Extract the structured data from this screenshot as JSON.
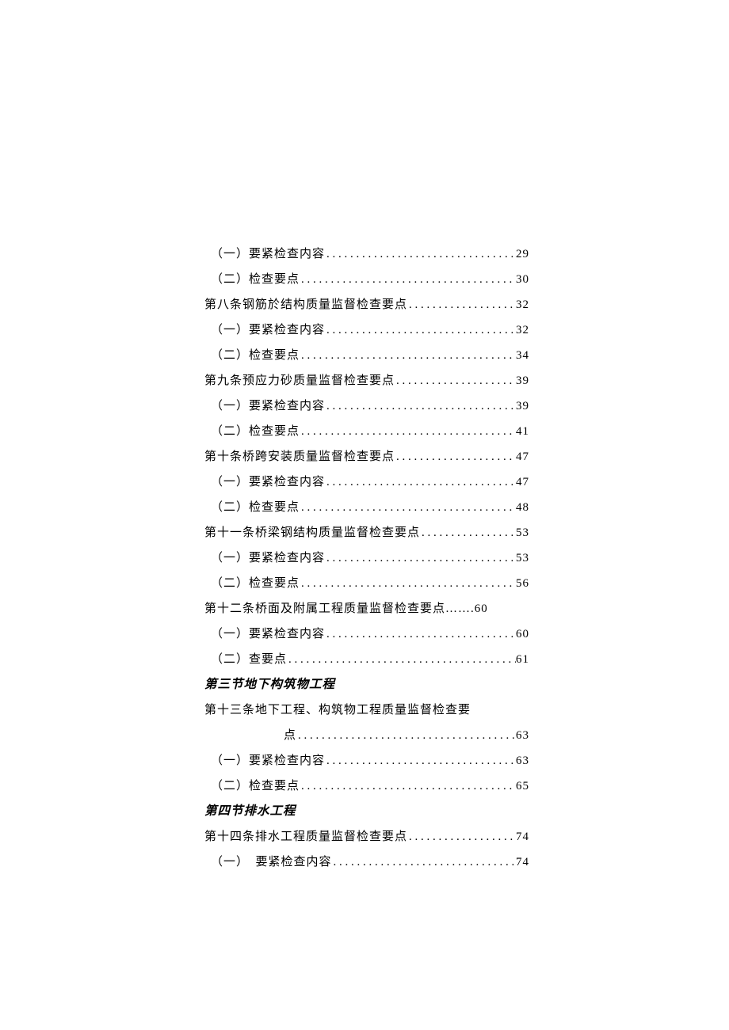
{
  "toc": {
    "entries": [
      {
        "label": "（一）要紧检查内容",
        "page": "29",
        "indent": true
      },
      {
        "label": "（二）检查要点",
        "page": "30",
        "indent": true
      },
      {
        "label": "第八条钢筋於结构质量监督检查要点",
        "page": "32",
        "indent": false
      },
      {
        "label": "（一）要紧检查内容",
        "page": "32",
        "indent": true
      },
      {
        "label": "（二）检查要点",
        "page": "34",
        "indent": true
      },
      {
        "label": "第九条预应力砂质量监督检查要点",
        "page": "39",
        "indent": false
      },
      {
        "label": "（一）要紧检查内容",
        "page": "39",
        "indent": true
      },
      {
        "label": "（二）检查要点",
        "page": "41",
        "indent": true
      },
      {
        "label": "第十条桥跨安装质量监督检查要点",
        "page": "47",
        "indent": false
      },
      {
        "label": "（一）要紧检查内容",
        "page": "47",
        "indent": true
      },
      {
        "label": "（二）检查要点",
        "page": "48",
        "indent": true
      },
      {
        "label": "第十一条桥梁钢结构质量监督检查要点",
        "page": "53",
        "indent": false
      },
      {
        "label": "（一）要紧检查内容",
        "page": "53",
        "indent": true
      },
      {
        "label": "（二）检查要点",
        "page": "56",
        "indent": true
      },
      {
        "label": "第十二条桥面及附属工程质量监督检查要点",
        "page": "60",
        "indent": false,
        "cndots": "……. "
      },
      {
        "label": "（一）要紧检查内容",
        "page": "60",
        "indent": true
      },
      {
        "label": "（二）查要点",
        "page": "61",
        "indent": true
      }
    ],
    "section3": {
      "title": "第三节地下构筑物工程",
      "wrap_line1": "第十三条地下工程、构筑物工程质量监督检查要",
      "wrap_cont": "点",
      "entries": [
        {
          "label_cont_page": "63"
        },
        {
          "label": "（一）要紧检查内容",
          "page": "63",
          "indent": true
        },
        {
          "label": "（二）检查要点",
          "page": "65",
          "indent": true
        }
      ]
    },
    "section4": {
      "title": "第四节排水工程",
      "entries": [
        {
          "label": "第十四条排水工程质量监督检查要点",
          "page": "74",
          "indent": false
        },
        {
          "label": "（一）　要紧检查内容",
          "page": "74",
          "indent": true
        }
      ]
    }
  }
}
